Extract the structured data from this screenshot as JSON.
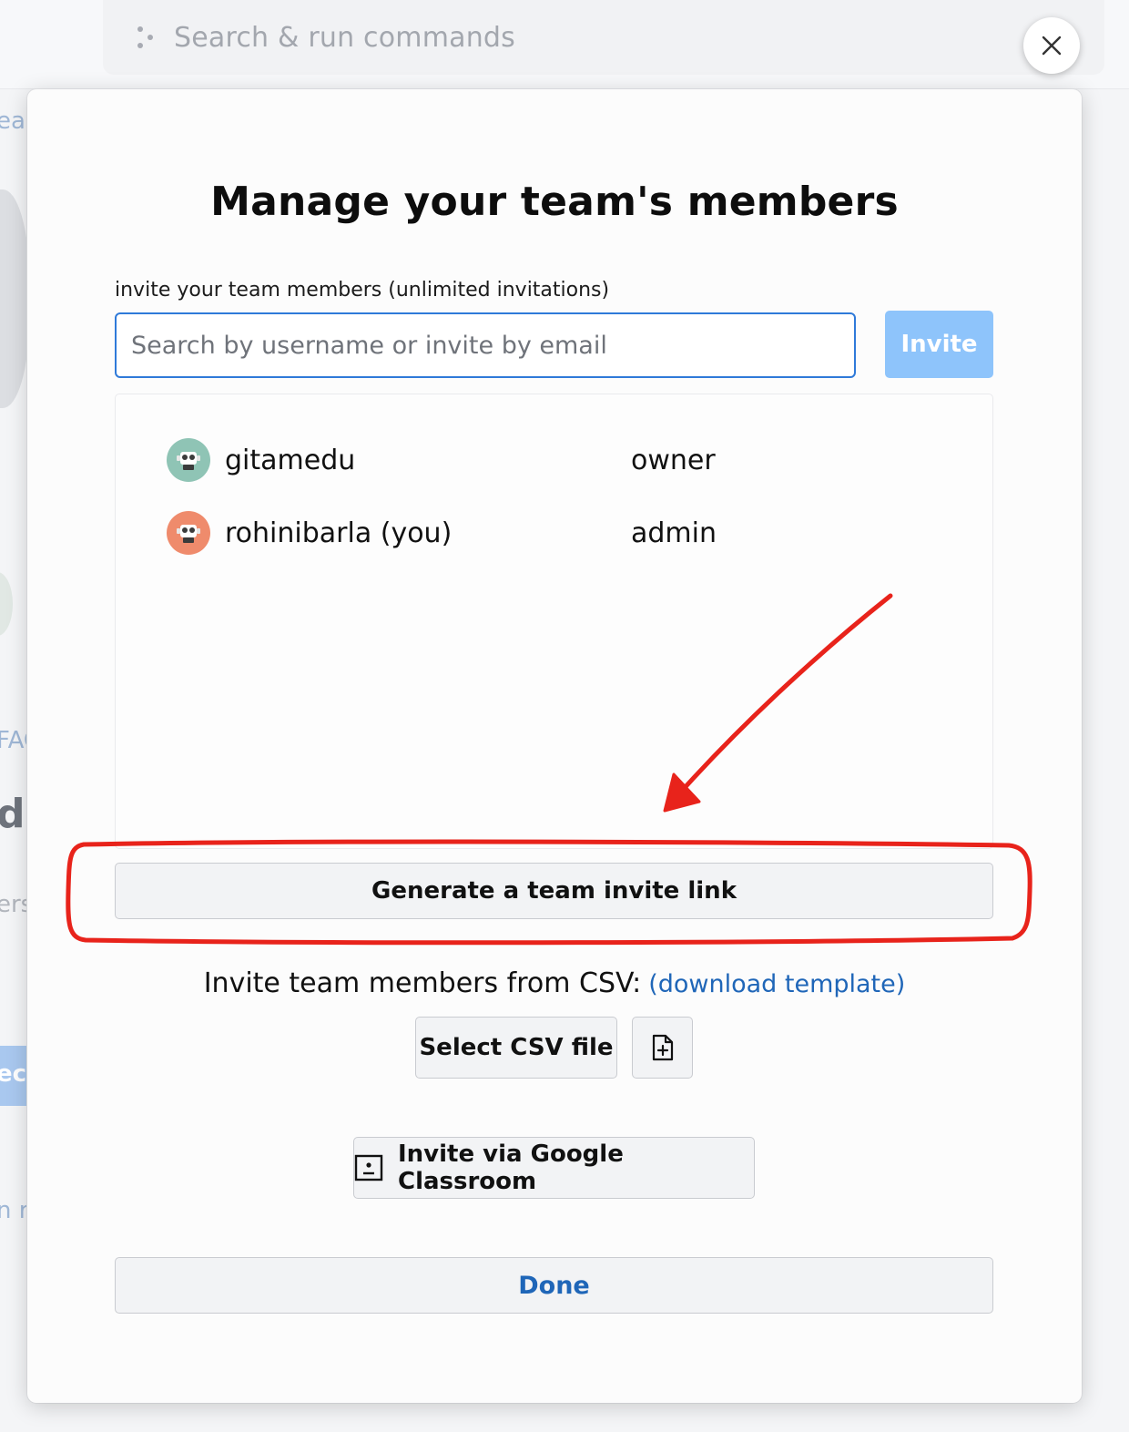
{
  "topbar": {
    "search_placeholder": "Search & run commands",
    "search_icon": "command-dots-icon"
  },
  "background": {
    "fragments": [
      "ea",
      "FAC",
      "d",
      "ers",
      "ec",
      "n r"
    ]
  },
  "close_icon": "close-icon",
  "modal": {
    "title": "Manage your team's members",
    "invite_label": "invite your team members (unlimited invitations)",
    "search_placeholder": "Search by username or invite by email",
    "search_value": "",
    "invite_button": "Invite",
    "members": [
      {
        "name": "gitamedu",
        "role": "owner",
        "avatar_color": "#8fc4b5"
      },
      {
        "name": "rohinibarla (you)",
        "role": "admin",
        "avatar_color": "#ef8b6c"
      }
    ],
    "generate_link_button": "Generate a team invite link",
    "csv_text": "Invite team members from CSV:",
    "csv_template_link": "(download template)",
    "select_csv_button": "Select CSV file",
    "new_file_icon": "file-plus-icon",
    "google_classroom_button": "Invite via Google Classroom",
    "google_classroom_icon": "classroom-icon",
    "done_button": "Done"
  },
  "annotation": {
    "color": "#e8231b",
    "shapes": [
      "arrow",
      "rounded-rectangle"
    ]
  }
}
